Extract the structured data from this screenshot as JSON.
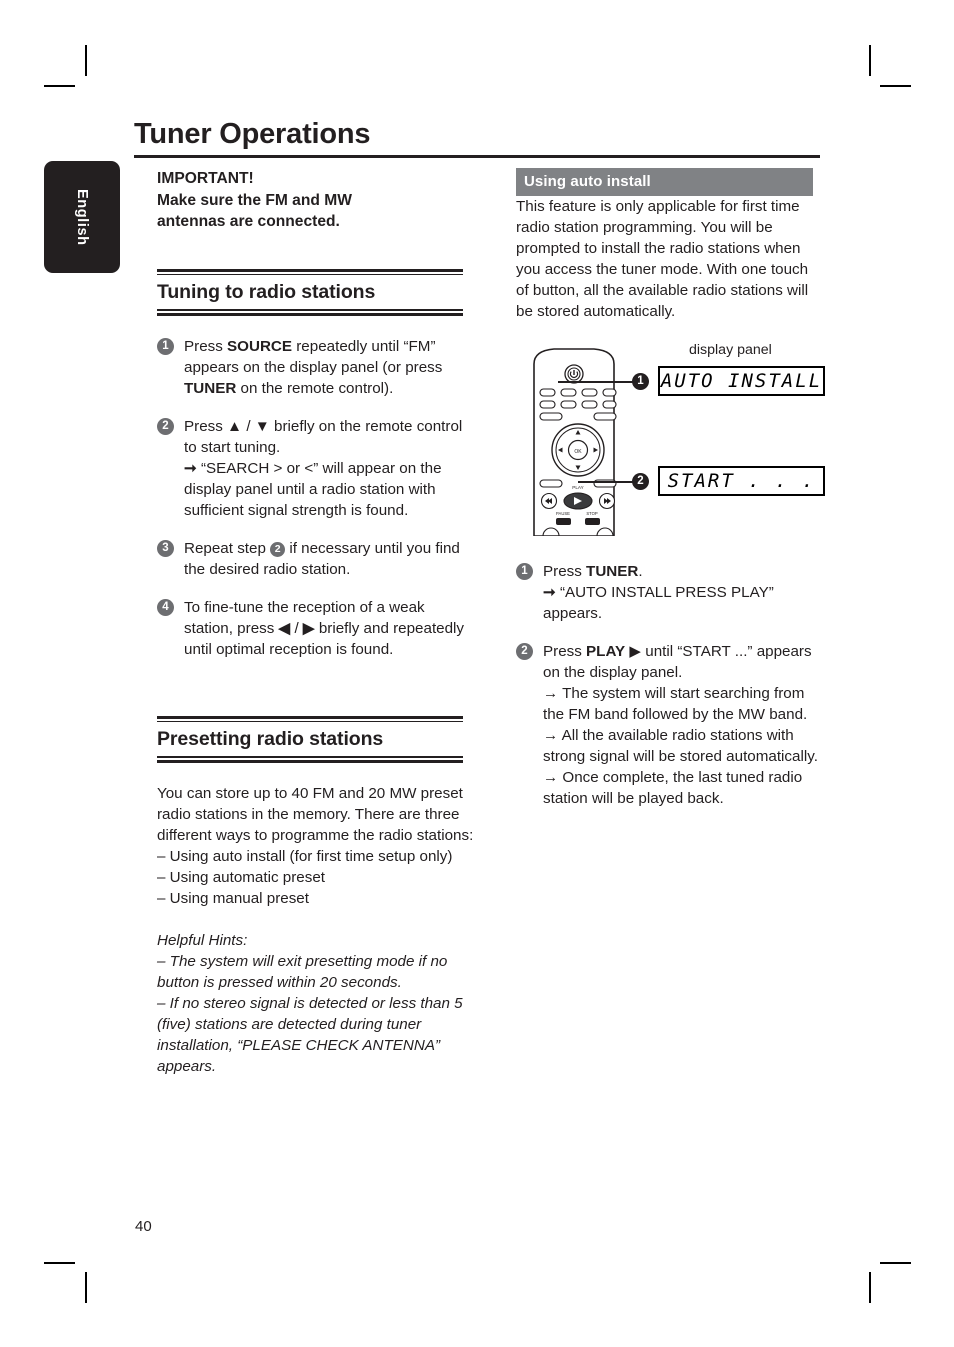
{
  "page": {
    "title": "Tuner Operations",
    "number": "40",
    "language_tab": "English"
  },
  "left_column": {
    "important": {
      "line1": "IMPORTANT!",
      "line2": "Make sure the FM and MW",
      "line3": "antennas are connected."
    },
    "tuning_section": {
      "heading": "Tuning to radio stations",
      "steps": [
        {
          "num": "1",
          "text_parts": [
            {
              "t": "Press ",
              "bold": false
            },
            {
              "t": "SOURCE",
              "bold": true
            },
            {
              "t": " repeatedly until “FM” appears on the display panel (or press ",
              "bold": false
            },
            {
              "t": "TUNER",
              "bold": true
            },
            {
              "t": " on the remote control).",
              "bold": false
            }
          ],
          "plain": "Press SOURCE repeatedly until “FM” appears on the display panel (or press TUNER on the remote control)."
        },
        {
          "num": "2",
          "plain": "Press ▲ / ▼ briefly on the remote control to start tuning.",
          "sub": "→ “SEARCH > or <” will appear on the display panel until a radio station with sufficient signal strength is found."
        },
        {
          "num": "3",
          "plain": "Repeat step ② if necessary until you find the desired radio station.",
          "pre": "Repeat step ",
          "post": " if necessary until you find the desired radio station.",
          "inline_num": "2"
        },
        {
          "num": "4",
          "plain": "To fine-tune the reception of a weak station, press ◀ / ▶ briefly and repeatedly until optimal reception is found."
        }
      ]
    },
    "presetting_section": {
      "heading": "Presetting radio stations",
      "intro": "You can store up to 40 FM and 20 MW preset radio stations in the memory. There are three different ways to programme the radio stations:",
      "options": [
        "–   Using auto install (for first time setup only)",
        "–   Using automatic preset",
        "–   Using manual preset"
      ],
      "hints_title": "Helpful Hints:",
      "hints": [
        "– The system will exit presetting mode if no button is pressed within 20 seconds.",
        "– If no stereo signal is detected or less than 5 (five) stations are detected during tuner installation, “PLEASE CHECK ANTENNA” appears."
      ]
    }
  },
  "right_column": {
    "bar_heading": "Using auto install",
    "intro": "This feature is only applicable for first time radio station programming.  You will be prompted to install the radio stations when you access the tuner mode.  With one touch of button, all the available radio stations will be stored automatically.",
    "figure": {
      "display_panel_label": "display panel",
      "lcd_1_text": "AUTO INSTALL",
      "lcd_2_text": "START . . .",
      "callout_1": "1",
      "callout_2": "2"
    },
    "steps": [
      {
        "num": "1",
        "pre": "Press ",
        "bold": "TUNER",
        "post": ".",
        "subs": [
          "→ “AUTO INSTALL PRESS PLAY” appears."
        ]
      },
      {
        "num": "2",
        "pre": "Press ",
        "bold": "PLAY",
        "post": " ▶ until “START ...” appears on the display panel.",
        "subs": [
          "→ The system will start searching from the FM band followed by the MW band.",
          "→ All the available radio stations with strong signal will be stored automatically.",
          "→ Once complete, the last tuned radio station will be played back."
        ]
      }
    ]
  },
  "colors": {
    "ink": "#231f20",
    "bar_grey": "#808285",
    "bullet_grey": "#6d6e71"
  }
}
